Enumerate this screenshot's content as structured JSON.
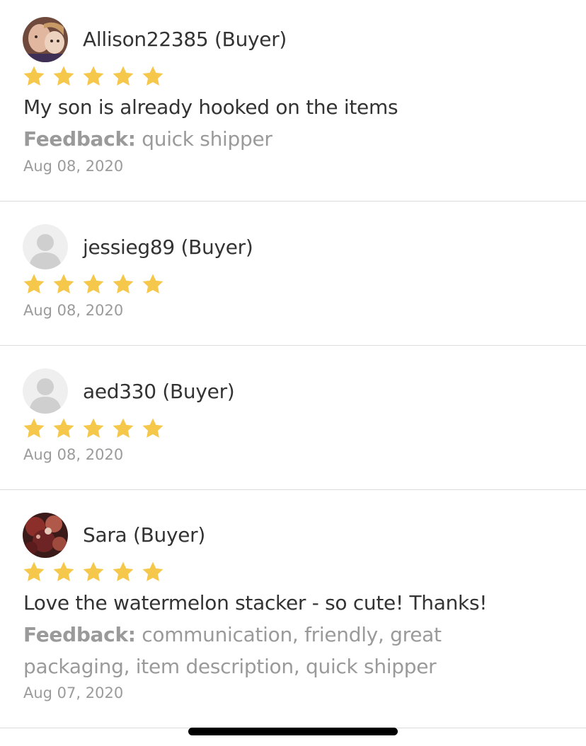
{
  "colors": {
    "star": "#F5C84C",
    "divider": "#DCDCDC",
    "muted_text": "#9A9A9A",
    "primary_text": "#333333"
  },
  "reviews": [
    {
      "username": "Allison22385 (Buyer)",
      "avatar": "photo-avatar",
      "rating": 5,
      "comment": "My son is already hooked on the items",
      "feedback_label": "Feedback:",
      "feedback_text": " quick shipper",
      "date": "Aug 08, 2020"
    },
    {
      "username": "jessieg89 (Buyer)",
      "avatar": "default-avatar",
      "rating": 5,
      "date": "Aug 08, 2020"
    },
    {
      "username": "aed330 (Buyer)",
      "avatar": "default-avatar",
      "rating": 5,
      "date": "Aug 08, 2020"
    },
    {
      "username": "Sara (Buyer)",
      "avatar": "photo-avatar",
      "rating": 5,
      "comment": "Love the watermelon stacker - so cute!  Thanks!",
      "feedback_label": "Feedback:",
      "feedback_text": " communication, friendly, great packaging, item description, quick shipper",
      "date": "Aug 07, 2020"
    }
  ]
}
